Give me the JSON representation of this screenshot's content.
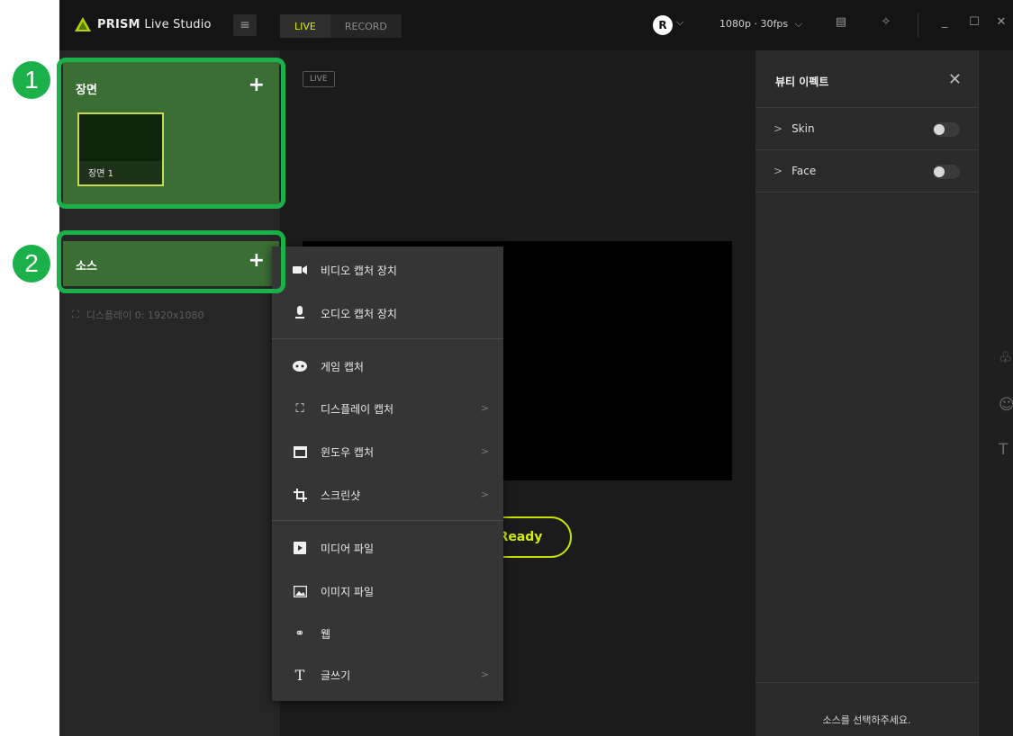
{
  "titlebar": {
    "brand": "PRISM",
    "app_name": "Live Studio",
    "menu_icon": "hamburger-icon",
    "tabs": [
      {
        "label": "LIVE",
        "active": true
      },
      {
        "label": "RECORD",
        "active": false
      }
    ],
    "user_initial": "R",
    "resolution": "1080p · 30fps",
    "window_controls": [
      "minimize-icon",
      "maximize-icon",
      "close-icon"
    ]
  },
  "left": {
    "scene_title": "장면",
    "scenes": [
      {
        "label": "장면 1"
      }
    ],
    "source_title": "소스",
    "sources": [
      {
        "label": "디스플레이 0: 1920x1080",
        "icon": "display-capture-icon"
      }
    ]
  },
  "callouts": [
    "1",
    "2"
  ],
  "center": {
    "live_badge": "LIVE",
    "ready_label": "Ready"
  },
  "context_menu": {
    "items": [
      {
        "label": "비디오 캡처 장치",
        "icon": "video-camera-icon",
        "submenu": false
      },
      {
        "label": "오디오 캡처 장치",
        "icon": "microphone-icon",
        "submenu": false
      },
      {
        "label": "게임 캡처",
        "icon": "gamepad-icon",
        "submenu": false
      },
      {
        "label": "디스플레이 캡처",
        "icon": "display-capture-icon",
        "submenu": true
      },
      {
        "label": "윈도우 캡처",
        "icon": "window-icon",
        "submenu": true
      },
      {
        "label": "스크린샷",
        "icon": "crop-icon",
        "submenu": true
      },
      {
        "label": "미디어 파일",
        "icon": "media-play-icon",
        "submenu": false
      },
      {
        "label": "이미지 파일",
        "icon": "image-icon",
        "submenu": false
      },
      {
        "label": "웹",
        "icon": "link-icon",
        "submenu": false
      },
      {
        "label": "글쓰기",
        "icon": "text-icon",
        "submenu": true
      }
    ]
  },
  "right_panel": {
    "title": "뷰티 이펙트",
    "rows": [
      {
        "label": "Skin",
        "enabled": false
      },
      {
        "label": "Face",
        "enabled": false
      }
    ],
    "footer": "소스를 선택하주세요."
  },
  "colors": {
    "accent": "#d4f000",
    "section_green": "#3b6e34",
    "callout_green": "#1bb04a"
  }
}
